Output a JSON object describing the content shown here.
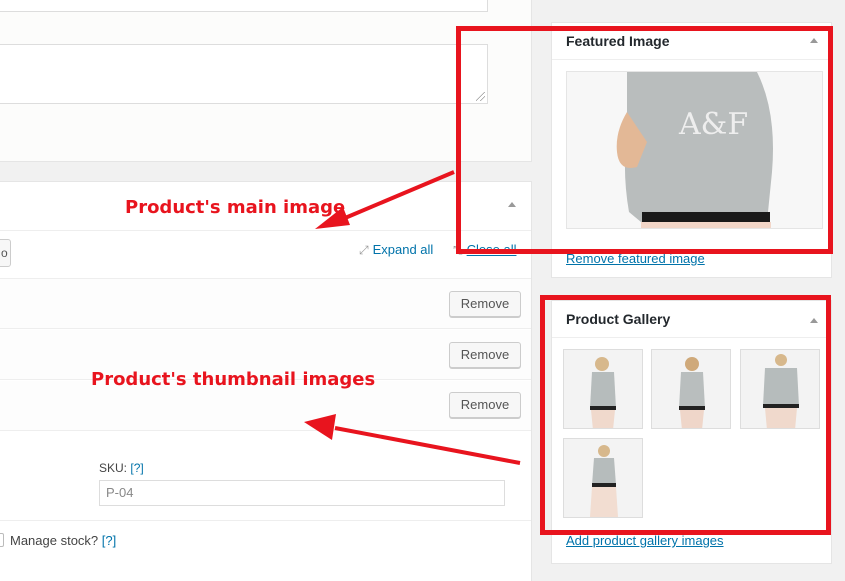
{
  "featured": {
    "title": "Featured Image",
    "remove_link": "Remove featured image",
    "image_text": "A&F"
  },
  "gallery": {
    "title": "Product Gallery",
    "add_link": "Add product gallery images"
  },
  "variations": {
    "expand_all": "Expand all",
    "close_all": "Close all",
    "remove_label": "Remove"
  },
  "inventory": {
    "sku_label": "SKU:",
    "help": "[?]",
    "sku_value": "P-04",
    "manage_stock_label": "Manage stock?"
  },
  "annotations": {
    "main": "Product's main image",
    "thumbs": "Product's thumbnail images"
  },
  "colors": {
    "annotation_red": "#e8141e",
    "link": "#0073aa"
  }
}
